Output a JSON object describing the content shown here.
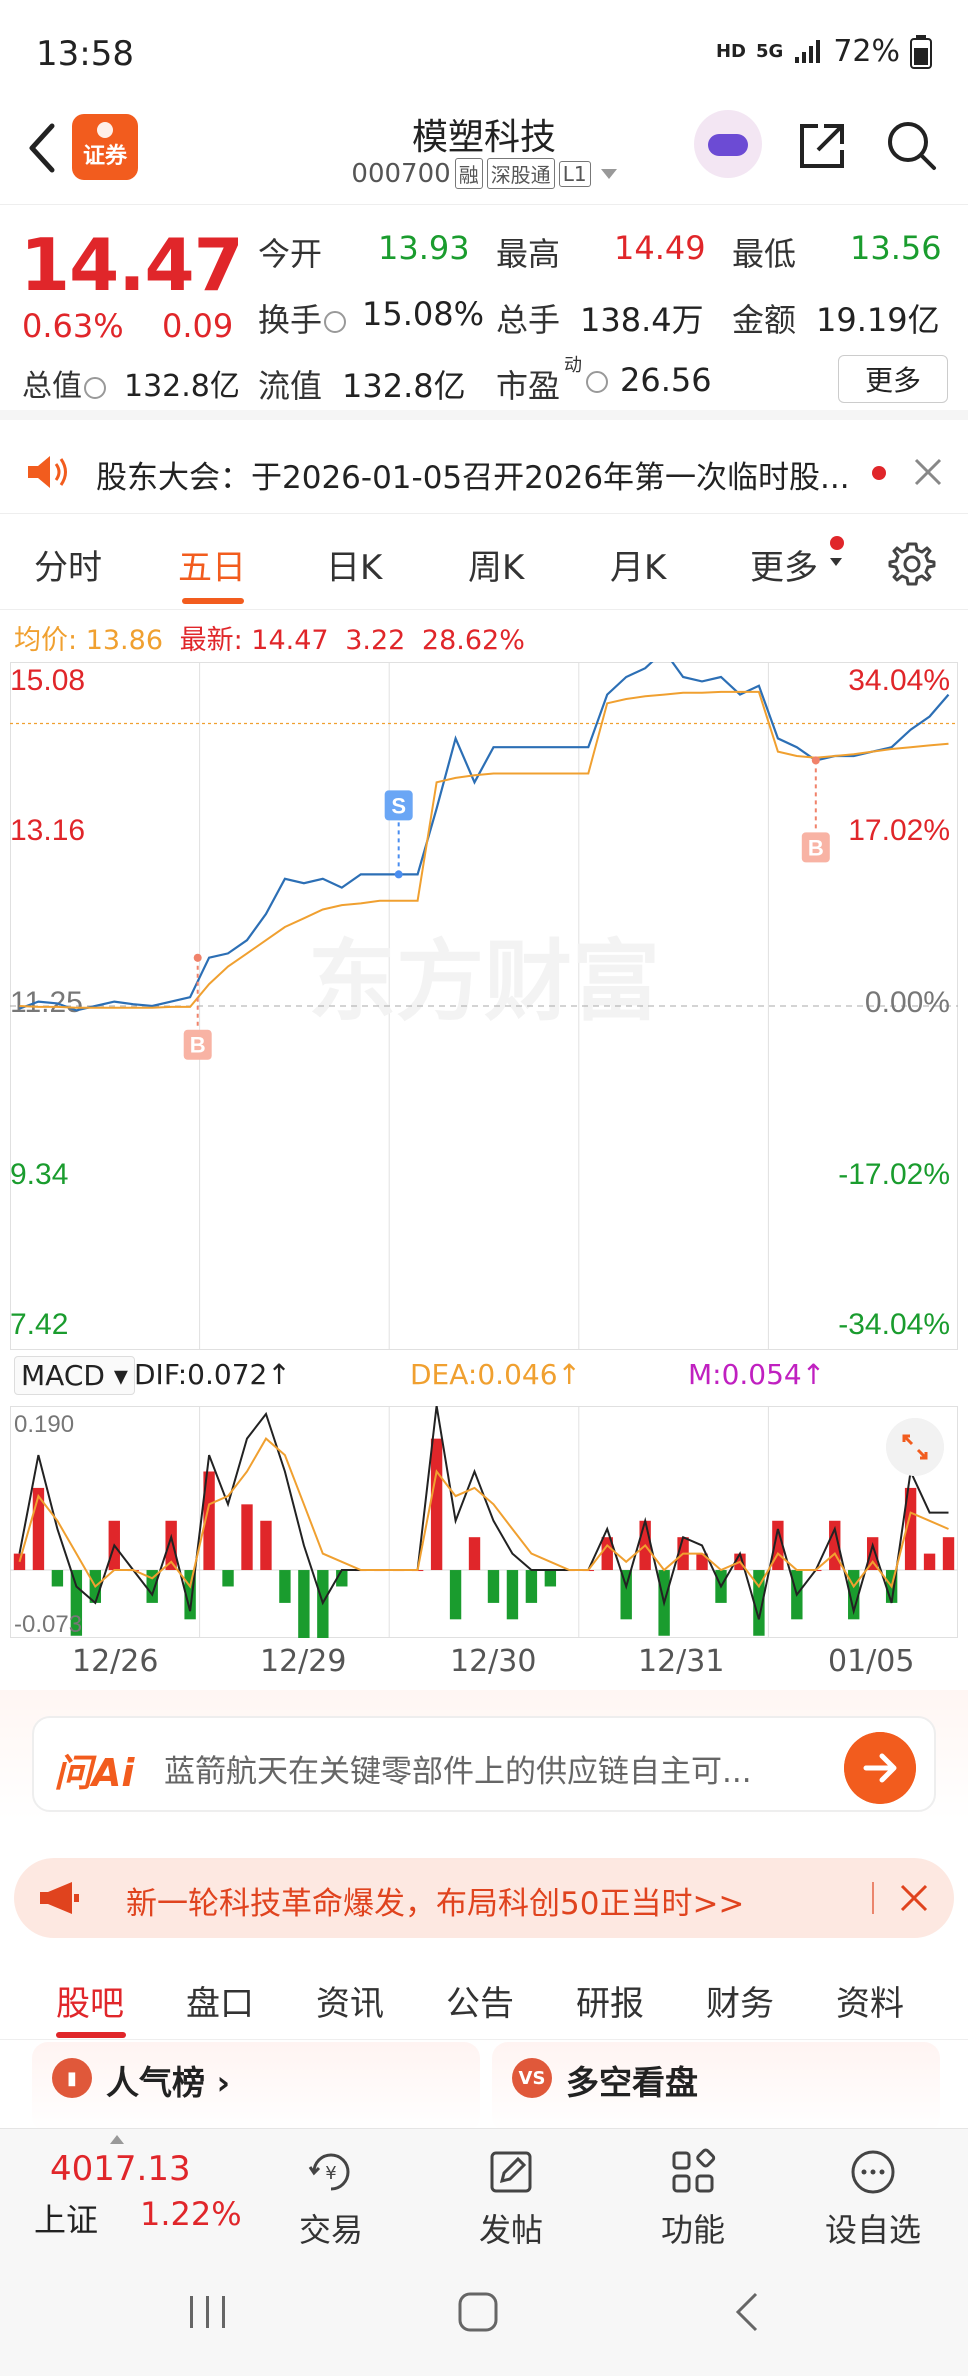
{
  "status": {
    "time": "13:58",
    "network": "HD",
    "signal": "5G",
    "battery": "72%"
  },
  "header": {
    "logo_text": "证券",
    "stock_name": "模塑科技",
    "stock_code": "000700",
    "tags": [
      "融",
      "深股通",
      "L1"
    ]
  },
  "quote": {
    "price": "14.47",
    "change_pct": "0.63%",
    "change": "0.09",
    "open_label": "今开",
    "open": "13.93",
    "high_label": "最高",
    "high": "14.49",
    "low_label": "最低",
    "low": "13.56",
    "turnover_label": "换手",
    "turnover": "15.08%",
    "volume_label": "总手",
    "volume": "138.4万",
    "amount_label": "金额",
    "amount": "19.19亿",
    "mcap_label": "总值",
    "mcap": "132.8亿",
    "float_label": "流值",
    "float": "132.8亿",
    "pe_label": "市盈",
    "pe_super": "动",
    "pe": "26.56",
    "more_label": "更多"
  },
  "notice": {
    "text": "股东大会：于2026-01-05召开2026年第一次临时股..."
  },
  "chart_tabs": [
    {
      "label": "分时",
      "active": false
    },
    {
      "label": "五日",
      "active": true
    },
    {
      "label": "日K",
      "active": false
    },
    {
      "label": "周K",
      "active": false
    },
    {
      "label": "月K",
      "active": false
    },
    {
      "label": "更多",
      "active": false
    }
  ],
  "avg_bar": {
    "avg_label": "均价:",
    "avg": "13.86",
    "latest_label": "最新:",
    "latest": "14.47",
    "chg": "3.22",
    "chg_pct": "28.62%"
  },
  "chart_data": {
    "type": "line",
    "title": "",
    "days": [
      "12/26",
      "12/29",
      "12/30",
      "12/31",
      "01/05"
    ],
    "ylim": [
      7.42,
      15.08
    ],
    "y_ticks_left": [
      "15.08",
      "13.16",
      "11.25",
      "9.34",
      "7.42"
    ],
    "y_ticks_right": [
      "34.04%",
      "17.02%",
      "0.00%",
      "-17.02%",
      "-34.04%"
    ],
    "prev_close": 11.25,
    "series": [
      {
        "values": [
          11.22,
          11.3,
          11.28,
          11.2,
          11.25,
          11.3,
          11.27,
          11.25,
          11.3,
          11.35,
          11.8,
          11.85,
          12.0,
          12.3,
          12.7,
          12.65,
          12.7,
          12.6,
          12.75,
          12.75,
          12.75,
          12.75,
          13.5,
          14.3,
          13.8,
          14.2,
          14.2,
          14.2,
          14.2,
          14.2,
          14.2,
          14.8,
          15.0,
          15.1,
          15.3,
          15.0,
          14.95,
          15.0,
          14.8,
          14.9,
          14.3,
          14.2,
          14.05,
          14.1,
          14.1,
          14.15,
          14.2,
          14.4,
          14.55,
          14.8
        ]
      },
      {
        "values": [
          11.25,
          11.24,
          11.24,
          11.23,
          11.23,
          11.23,
          11.23,
          11.23,
          11.24,
          11.24,
          11.5,
          11.7,
          11.85,
          12.0,
          12.15,
          12.25,
          12.35,
          12.4,
          12.42,
          12.45,
          12.45,
          12.45,
          13.8,
          13.85,
          13.88,
          13.9,
          13.9,
          13.9,
          13.9,
          13.9,
          13.9,
          14.7,
          14.75,
          14.78,
          14.8,
          14.82,
          14.82,
          14.83,
          14.83,
          14.83,
          14.15,
          14.1,
          14.08,
          14.1,
          14.12,
          14.15,
          14.18,
          14.2,
          14.22,
          14.24
        ]
      }
    ],
    "markers": [
      {
        "label": "B",
        "day": "12/26"
      },
      {
        "label": "S",
        "day": "12/30"
      },
      {
        "label": "B",
        "day": "01/05"
      }
    ],
    "watermark": "东方财富"
  },
  "macd": {
    "selector": "MACD",
    "dif": "DIF:0.072↑",
    "dea": "DEA:0.046↑",
    "m": "M:0.054↑",
    "top": "0.190",
    "bottom": "-0.073",
    "dif_values": [
      0.02,
      0.14,
      0.05,
      -0.02,
      -0.04,
      0.03,
      0.0,
      -0.03,
      0.04,
      -0.05,
      0.14,
      0.08,
      0.16,
      0.19,
      0.12,
      0.03,
      -0.04,
      0.0,
      0.0,
      0.0,
      0.0,
      0.0,
      0.2,
      0.06,
      0.12,
      0.06,
      0.02,
      0.0,
      0.0,
      0.0,
      0.0,
      0.05,
      -0.02,
      0.06,
      -0.04,
      0.04,
      0.03,
      -0.02,
      0.02,
      -0.06,
      0.05,
      -0.03,
      0.0,
      0.05,
      -0.05,
      0.03,
      -0.04,
      0.12,
      0.07,
      0.07
    ],
    "dea_values": [
      0.01,
      0.09,
      0.06,
      0.02,
      -0.02,
      0.0,
      0.0,
      -0.01,
      0.01,
      -0.02,
      0.08,
      0.09,
      0.12,
      0.16,
      0.14,
      0.08,
      0.02,
      0.01,
      0.0,
      0.0,
      0.0,
      0.0,
      0.12,
      0.09,
      0.1,
      0.08,
      0.05,
      0.02,
      0.01,
      0.0,
      0.0,
      0.03,
      0.01,
      0.03,
      0.0,
      0.02,
      0.02,
      0.0,
      0.01,
      -0.02,
      0.02,
      0.0,
      0.0,
      0.02,
      -0.02,
      0.01,
      -0.02,
      0.07,
      0.06,
      0.05
    ]
  },
  "ai": {
    "logo": "问Ai",
    "text": "蓝箭航天在关键零部件上的供应链自主可..."
  },
  "promo": {
    "text": "新一轮科技革命爆发，布局科创50正当时>>"
  },
  "section_tabs": [
    {
      "label": "股吧",
      "active": true
    },
    {
      "label": "盘口",
      "active": false
    },
    {
      "label": "资讯",
      "active": false
    },
    {
      "label": "公告",
      "active": false
    },
    {
      "label": "研报",
      "active": false
    },
    {
      "label": "财务",
      "active": false
    },
    {
      "label": "资料",
      "active": false
    }
  ],
  "cards": {
    "left_icon": "hot-ranking-icon",
    "left_title": "人气榜",
    "right_icon": "vs-icon",
    "right_icon_text": "VS",
    "right_title": "多空看盘"
  },
  "bottom_nav": {
    "index_value": "4017.13",
    "index_name": "上证",
    "index_pct": "1.22%",
    "items": [
      "交易",
      "发帖",
      "功能",
      "设自选"
    ]
  },
  "colors": {
    "up": "#e0262a",
    "down": "#1a9c2e",
    "accent": "#f25c1e",
    "price_line": "#2c6fb5",
    "avg_line": "#f0a030"
  }
}
